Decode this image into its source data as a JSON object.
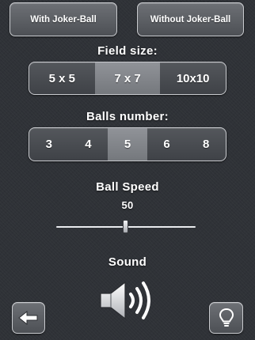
{
  "modes": {
    "with_joker": "With Joker-Ball",
    "without_joker": "Without Joker-Ball"
  },
  "field_size": {
    "label": "Field size:",
    "options": [
      "5 x 5",
      "7 x 7",
      "10x10"
    ],
    "selected": "7 x 7"
  },
  "balls_number": {
    "label": "Balls number:",
    "options": [
      "3",
      "4",
      "5",
      "6",
      "8"
    ],
    "selected": "5"
  },
  "ball_speed": {
    "label": "Ball Speed",
    "value": "50",
    "min": 0,
    "max": 100
  },
  "sound": {
    "label": "Sound",
    "icon": "speaker-volume-icon"
  },
  "footer": {
    "back_icon": "arrow-left-icon",
    "hint_icon": "lightbulb-icon"
  },
  "colors": {
    "background": "#2f3237",
    "control_border": "#c9cbcf",
    "selected_segment": "#84878c",
    "text": "#ffffff"
  }
}
